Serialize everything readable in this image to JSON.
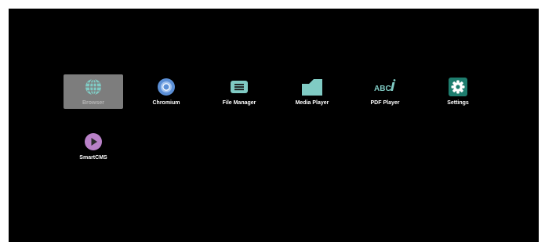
{
  "launcher": {
    "apps": [
      {
        "label": "Browser",
        "icon": "globe-icon",
        "selected": true
      },
      {
        "label": "Chromium",
        "icon": "chromium-icon",
        "selected": false
      },
      {
        "label": "File Manager",
        "icon": "file-manager-icon",
        "selected": false
      },
      {
        "label": "Media Player",
        "icon": "folder-icon",
        "selected": false
      },
      {
        "label": "PDF Player",
        "icon": "pdf-abc-icon",
        "icon_text": "ABC",
        "selected": false
      },
      {
        "label": "Settings",
        "icon": "gear-icon",
        "selected": false
      },
      {
        "label": "SmartCMS",
        "icon": "play-icon",
        "selected": false
      }
    ]
  },
  "colors": {
    "screen_background": "#000000",
    "selected_tile": "#7d7d7d",
    "icon_teal": "#80cbc4",
    "settings_green": "#1e7d6e",
    "chromium_blue": "#5b8fd6",
    "smartcms_purple": "#b981c8",
    "label_text": "#ffffff"
  }
}
